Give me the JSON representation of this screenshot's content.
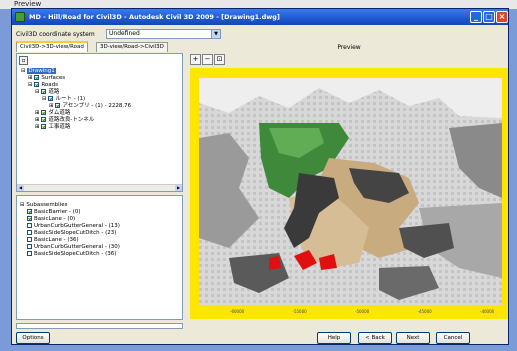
{
  "screen_caption": "Preview",
  "window": {
    "title": "MD - Hill/Road for Civil3D - Autodesk Civil 3D 2009 - [Drawing1.dwg]",
    "minimize_glyph": "_",
    "maximize_glyph": "□",
    "close_glyph": "×"
  },
  "coordinate_system": {
    "label": "Civil3D coordinate system",
    "value": "Undefined"
  },
  "tabs": [
    {
      "label": "Civil3D->3D-view/Road",
      "active": true
    },
    {
      "label": "3D-view/Road->Civil3D",
      "active": false
    }
  ],
  "preview": {
    "label": "Preview",
    "tools": [
      {
        "name": "zoom-in-icon",
        "glyph": "+"
      },
      {
        "name": "zoom-out-icon",
        "glyph": "−"
      },
      {
        "name": "zoom-extents-icon",
        "glyph": "⊡"
      }
    ],
    "x_ticks": [
      "-60000",
      "-55000",
      "-50000",
      "-45000",
      "-40000"
    ]
  },
  "tree": {
    "items": [
      {
        "label": "Drawing1",
        "level": 0,
        "expander": "-",
        "selected": true
      },
      {
        "label": "Surfaces",
        "level": 1,
        "expander": "+"
      },
      {
        "label": "Roads",
        "level": 1,
        "expander": "-"
      },
      {
        "label": "道路",
        "level": 2,
        "expander": "-"
      },
      {
        "label": "ルート - (1)",
        "level": 3,
        "expander": "-"
      },
      {
        "label": "アセンブリ - (1) - 2228.76",
        "level": 4,
        "expander": "+"
      },
      {
        "label": "ダム道路",
        "level": 2,
        "expander": "+"
      },
      {
        "label": "道路改良-トンネル",
        "level": 2,
        "expander": "+"
      },
      {
        "label": "工事道路",
        "level": 2,
        "expander": "+"
      }
    ]
  },
  "subassemblies": {
    "header": "Subassemblies",
    "items": [
      {
        "label": "BasicBarrier - (0)",
        "checked": true
      },
      {
        "label": "BasicLane - (0)",
        "checked": true
      },
      {
        "label": "UrbanCurbGutterGeneral - (13)",
        "checked": false
      },
      {
        "label": "BasicSideSlopeCutDitch - (23)",
        "checked": false
      },
      {
        "label": "BasicLane - (36)",
        "checked": false
      },
      {
        "label": "UrbanCurbGutterGeneral - (30)",
        "checked": false
      },
      {
        "label": "BasicSideSlopeCutDitch - (36)",
        "checked": false
      }
    ]
  },
  "buttons": {
    "options": "Options",
    "help": "Help",
    "back": "< Back",
    "next": "Next",
    "cancel": "Cancel"
  },
  "colors": {
    "title_bar": "#1f58d0",
    "frame": "#ffe600",
    "terrain_green": "#3f8a3a",
    "terrain_dark": "#3a3a3a",
    "terrain_tan": "#c9ab80",
    "highlight_red": "#e01010"
  }
}
